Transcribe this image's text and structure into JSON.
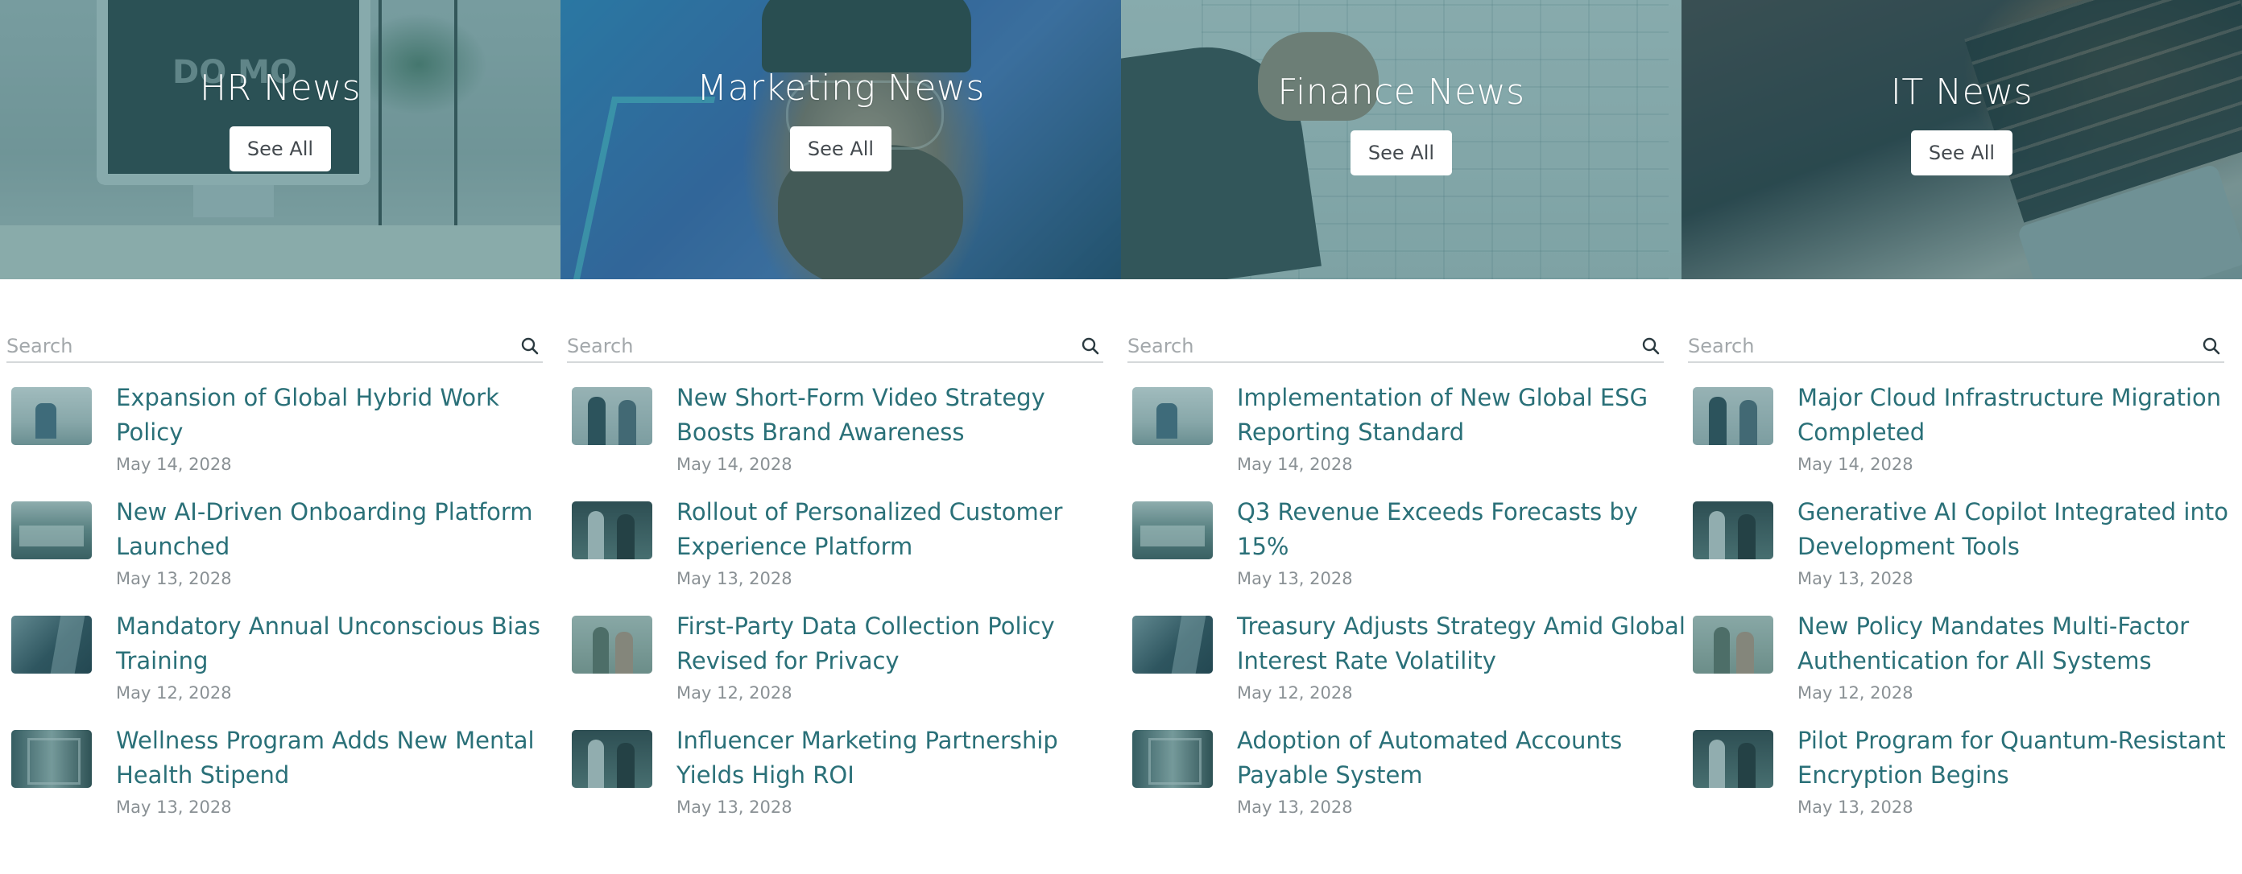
{
  "heroes": [
    {
      "title": "HR News",
      "button": "See All",
      "monitor_text": "DO MO"
    },
    {
      "title": "Marketing News",
      "button": "See All"
    },
    {
      "title": "Finance News",
      "button": "See All"
    },
    {
      "title": "IT News",
      "button": "See All"
    }
  ],
  "columns": [
    {
      "search_placeholder": "Search",
      "items": [
        {
          "title": "Expansion of Global Hybrid Work Policy",
          "date": "May 14, 2028"
        },
        {
          "title": "New AI-Driven Onboarding Platform Launched",
          "date": "May 13, 2028"
        },
        {
          "title": "Mandatory Annual Unconscious Bias Training",
          "date": "May 12, 2028"
        },
        {
          "title": "Wellness Program Adds New Mental Health Stipend",
          "date": "May 13, 2028"
        }
      ]
    },
    {
      "search_placeholder": "Search",
      "items": [
        {
          "title": "New Short-Form Video Strategy Boosts Brand Awareness",
          "date": "May 14, 2028"
        },
        {
          "title": "Rollout of Personalized Customer Experience Platform",
          "date": "May 13, 2028"
        },
        {
          "title": "First-Party Data Collection Policy Revised for Privacy",
          "date": "May 12, 2028"
        },
        {
          "title": "Influencer Marketing Partnership Yields High ROI",
          "date": "May 13, 2028"
        }
      ]
    },
    {
      "search_placeholder": "Search",
      "items": [
        {
          "title": "Implementation of New Global ESG Reporting Standard",
          "date": "May 14, 2028"
        },
        {
          "title": "Q3 Revenue Exceeds Forecasts by 15%",
          "date": "May 13, 2028"
        },
        {
          "title": "Treasury Adjusts Strategy Amid Global Interest Rate Volatility",
          "date": "May 12, 2028"
        },
        {
          "title": "Adoption of Automated Accounts Payable System",
          "date": "May 13, 2028"
        }
      ]
    },
    {
      "search_placeholder": "Search",
      "items": [
        {
          "title": "Major Cloud Infrastructure Migration Completed",
          "date": "May 14, 2028"
        },
        {
          "title": "Generative AI Copilot Integrated into Development Tools",
          "date": "May 13, 2028"
        },
        {
          "title": "New Policy Mandates Multi-Factor Authentication for All Systems",
          "date": "May 12, 2028"
        },
        {
          "title": "Pilot Program for Quantum-Resistant Encryption Begins",
          "date": "May 13, 2028"
        }
      ]
    }
  ],
  "icons": {
    "search": "search-icon"
  },
  "colors": {
    "accent": "#2a7078",
    "overlay": "#286e73",
    "date": "#8a9195"
  }
}
